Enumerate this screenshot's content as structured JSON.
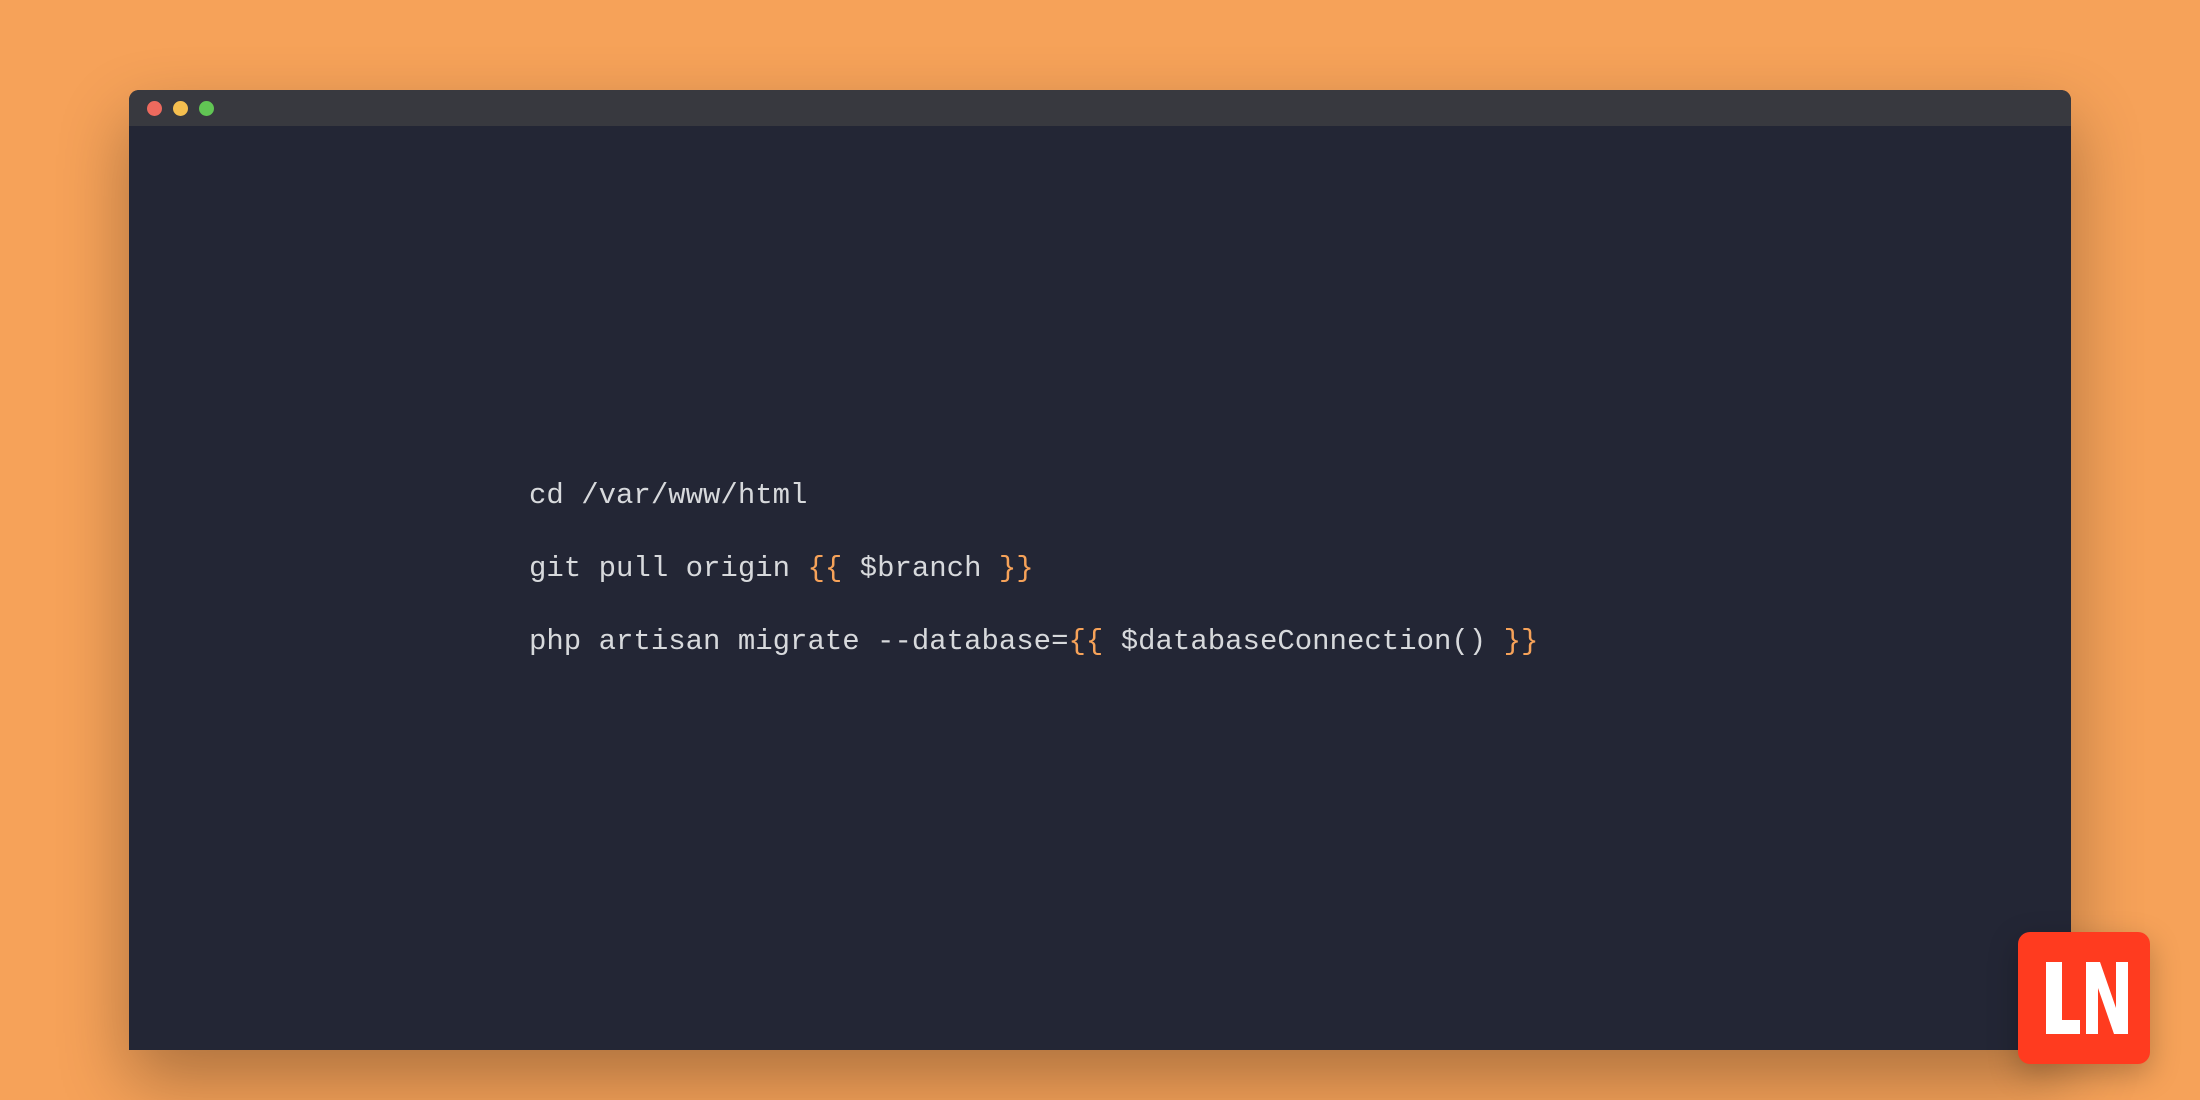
{
  "colors": {
    "background": "#f6a259",
    "window_bg": "#232635",
    "titlebar_bg": "#38393f",
    "traffic_close": "#ed6a5e",
    "traffic_min": "#f5bf4f",
    "traffic_max": "#61c554",
    "code_text": "#d7d9dc",
    "code_brace": "#f6a259",
    "brand_bg": "#ff3b1f",
    "brand_fg": "#ffffff"
  },
  "code": {
    "line1": {
      "text": "cd /var/www/html"
    },
    "line2": {
      "prefix": "git pull origin ",
      "brace_open": "{{",
      "inner": " $branch ",
      "brace_close": "}}"
    },
    "line3": {
      "prefix": "php artisan migrate --database=",
      "brace_open": "{{",
      "inner": " $databaseConnection() ",
      "brace_close": "}}"
    }
  },
  "brand": {
    "letters": "LN"
  }
}
